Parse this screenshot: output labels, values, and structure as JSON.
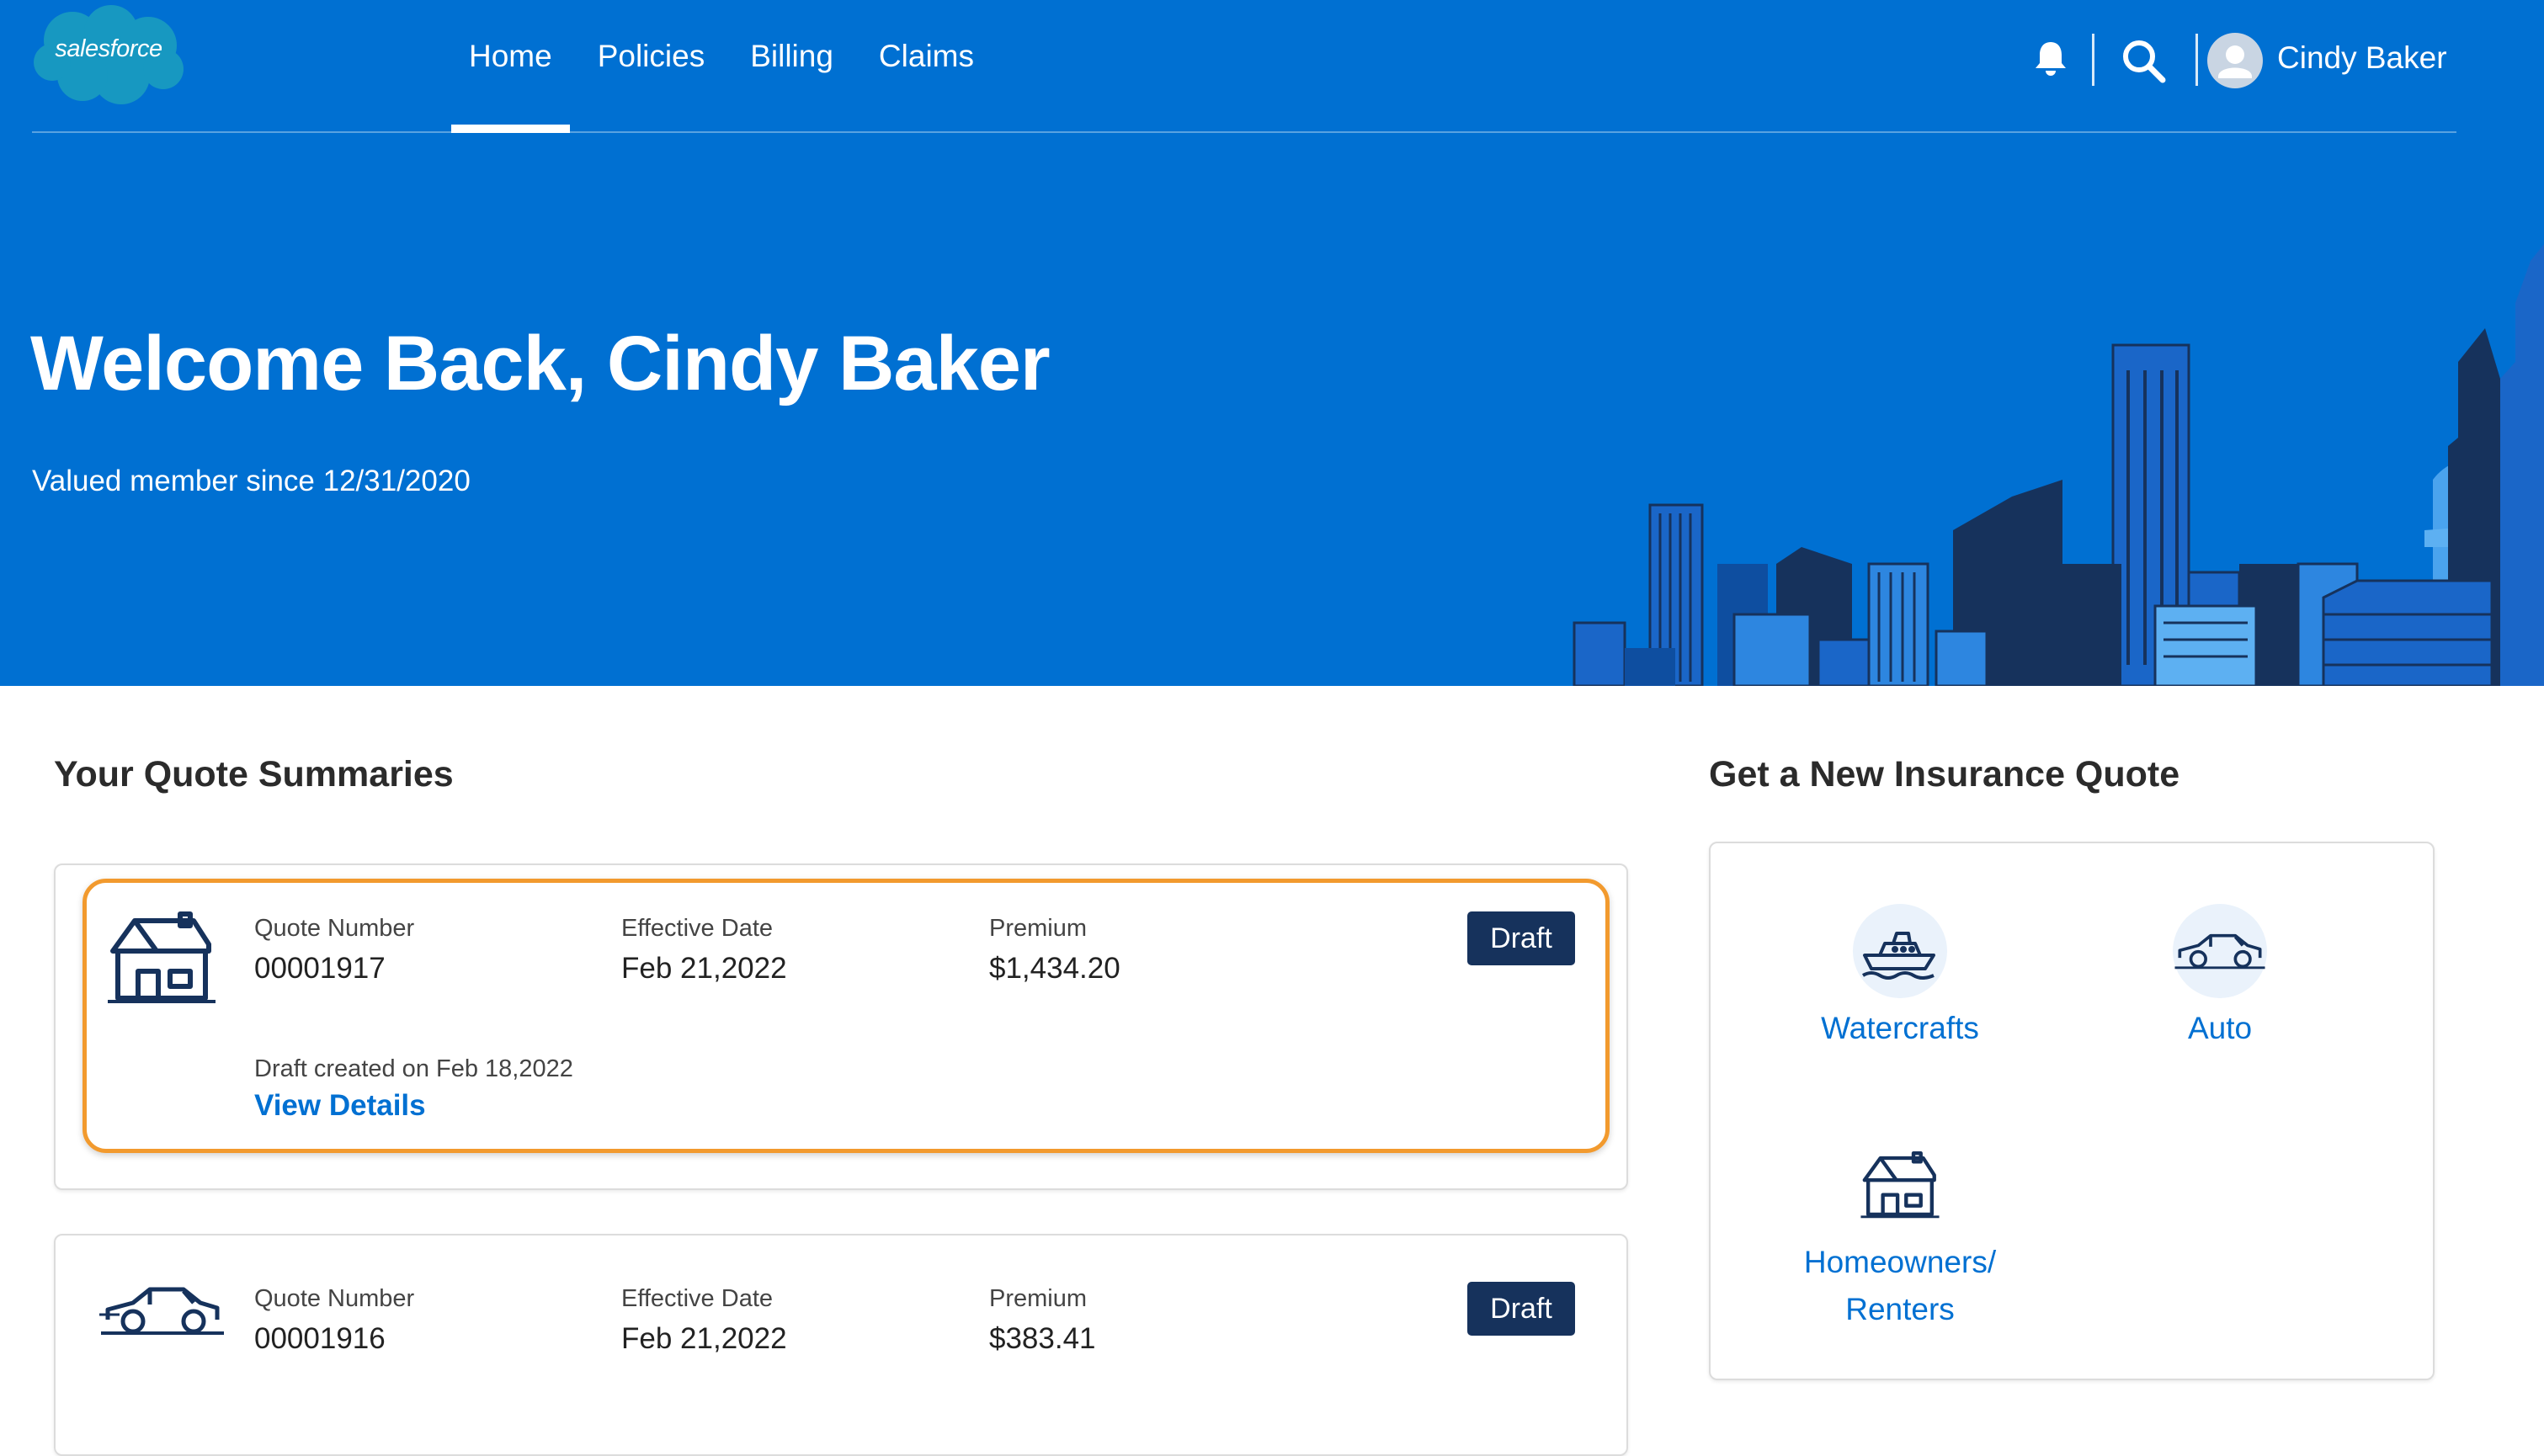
{
  "header": {
    "logo_text": "salesforce",
    "nav": [
      {
        "label": "Home",
        "active": true
      },
      {
        "label": "Policies",
        "active": false
      },
      {
        "label": "Billing",
        "active": false
      },
      {
        "label": "Claims",
        "active": false
      }
    ],
    "icons": [
      "bell-icon",
      "search-icon",
      "user-avatar-icon"
    ],
    "user_name": "Cindy Baker"
  },
  "hero": {
    "title": "Welcome Back, Cindy Baker",
    "subtitle": "Valued member since 12/31/2020"
  },
  "quotes": {
    "section_title": "Your Quote Summaries",
    "items": [
      {
        "icon": "house-icon",
        "quote_number_label": "Quote Number",
        "quote_number": "00001917",
        "effective_date_label": "Effective Date",
        "effective_date": "Feb 21,2022",
        "premium_label": "Premium",
        "premium": "$1,434.20",
        "status": "Draft",
        "draft_note": "Draft created on Feb 18,2022",
        "link_label": "View Details"
      },
      {
        "icon": "car-icon",
        "quote_number_label": "Quote Number",
        "quote_number": "00001916",
        "effective_date_label": "Effective Date",
        "effective_date": "Feb 21,2022",
        "premium_label": "Premium",
        "premium": "$383.41",
        "status": "Draft"
      }
    ]
  },
  "new_quote": {
    "section_title": "Get a New Insurance Quote",
    "products": [
      {
        "label": "Watercrafts",
        "icon": "boat-icon"
      },
      {
        "label": "Auto",
        "icon": "car-icon"
      },
      {
        "label_line1": "Homeowners/",
        "label_line2": "Renters",
        "icon": "house-icon"
      }
    ]
  },
  "colors": {
    "brand_blue": "#0070d2",
    "badge_navy": "#16325c",
    "highlight_orange": "#f29a2e",
    "skyline_dark": "#16325c"
  }
}
